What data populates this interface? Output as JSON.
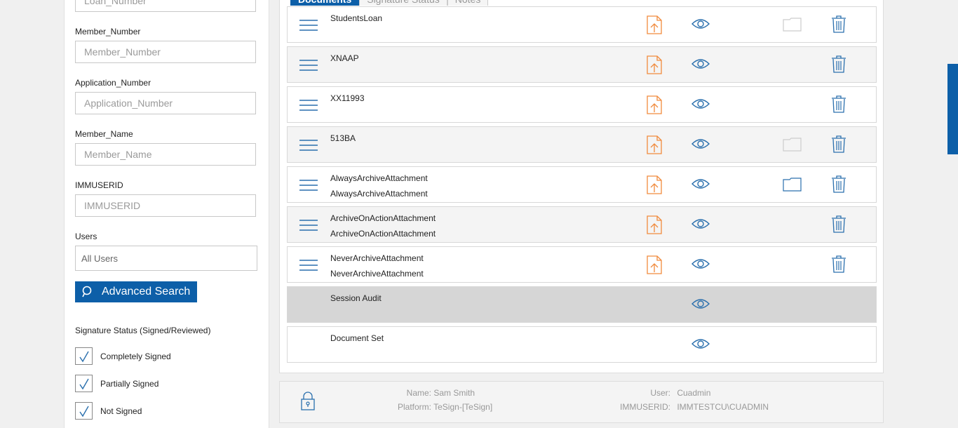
{
  "filters": {
    "loan_number": {
      "placeholder": "Loan_Number"
    },
    "member_number": {
      "label": "Member_Number",
      "placeholder": "Member_Number"
    },
    "application_number": {
      "label": "Application_Number",
      "placeholder": "Application_Number"
    },
    "member_name": {
      "label": "Member_Name",
      "placeholder": "Member_Name"
    },
    "immuserid": {
      "label": "IMMUSERID",
      "placeholder": "IMMUSERID"
    },
    "users": {
      "label": "Users",
      "value": "All Users"
    },
    "advanced_search_label": "Advanced Search"
  },
  "signature_status": {
    "title": "Signature Status (Signed/Reviewed)",
    "options": [
      {
        "label": "Completely Signed",
        "checked": true
      },
      {
        "label": "Partially Signed",
        "checked": true
      },
      {
        "label": "Not Signed",
        "checked": true
      }
    ]
  },
  "tabs": [
    {
      "label": "Documents",
      "active": true
    },
    {
      "label": "Signature Status",
      "active": false
    },
    {
      "label": "Notes",
      "active": false
    }
  ],
  "documents": [
    {
      "line1": "StudentsLoan",
      "line2": ""
    },
    {
      "line1": "XNAAP",
      "line2": ""
    },
    {
      "line1": "XX11993",
      "line2": ""
    },
    {
      "line1": "513BA",
      "line2": ""
    },
    {
      "line1": "AlwaysArchiveAttachment",
      "line2": "AlwaysArchiveAttachment"
    },
    {
      "line1": "ArchiveOnActionAttachment",
      "line2": "ArchiveOnActionAttachment"
    },
    {
      "line1": "NeverArchiveAttachment",
      "line2": "NeverArchiveAttachment"
    },
    {
      "line1": "Session Audit",
      "line2": ""
    },
    {
      "line1": "Document Set",
      "line2": ""
    }
  ],
  "footer": {
    "name_label": "Name:",
    "name_value": "Sam Smith",
    "platform_label": "Platform:",
    "platform_value": "TeSign-[TeSign]",
    "user_label": "User:",
    "user_value": "Cuadmin",
    "immuserid_label": "IMMUSERID:",
    "immuserid_value": "IMMTESTCU\\CUADMIN"
  },
  "colors": {
    "accent": "#0d5fa8",
    "upload": "#f08a3c",
    "icon_blue": "#2a6fad"
  }
}
